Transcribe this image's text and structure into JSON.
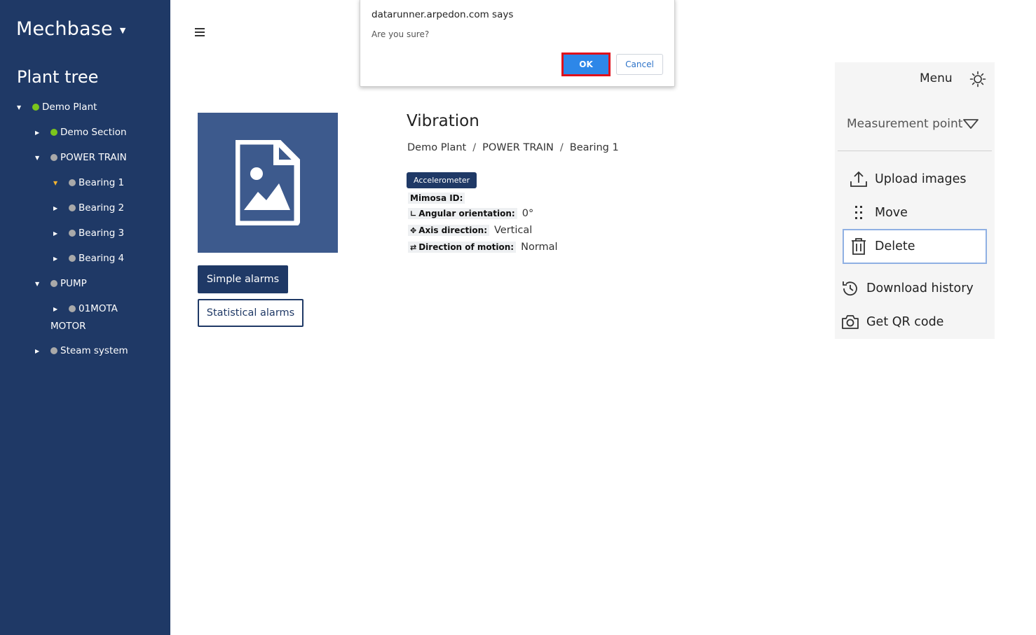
{
  "sidebar": {
    "brand": "Mechbase",
    "tree_title": "Plant tree",
    "nodes": [
      {
        "label": "Demo Plant",
        "status": "green"
      },
      {
        "label": "Demo Section",
        "status": "green"
      },
      {
        "label": "POWER TRAIN",
        "status": "gray"
      },
      {
        "label": "Bearing 1",
        "status": "gray"
      },
      {
        "label": "Bearing 2",
        "status": "gray"
      },
      {
        "label": "Bearing 3",
        "status": "gray"
      },
      {
        "label": "Bearing 4",
        "status": "gray"
      },
      {
        "label": "PUMP",
        "status": "gray"
      },
      {
        "label": "01MOTA",
        "status": "gray"
      },
      {
        "label": "MOTOR",
        "status": "gray"
      },
      {
        "label": "Steam system",
        "status": "gray"
      }
    ]
  },
  "dialog": {
    "title": "datarunner.arpedon.com says",
    "message": "Are you sure?",
    "ok_label": "OK",
    "cancel_label": "Cancel"
  },
  "main": {
    "title": "Vibration",
    "breadcrumb": [
      "Demo Plant",
      "POWER TRAIN",
      "Bearing 1"
    ],
    "breadcrumb_sep": "/",
    "badge": "Accelerometer",
    "props": [
      {
        "key": "Mimosa ID:",
        "value": ""
      },
      {
        "key": "Angular orientation:",
        "value": "0°"
      },
      {
        "key": "Axis direction:",
        "value": "Vertical"
      },
      {
        "key": "Direction of motion:",
        "value": "Normal"
      }
    ],
    "simple_alarms_label": "Simple alarms",
    "statistical_alarms_label": "Statistical alarms"
  },
  "menu": {
    "title": "Menu",
    "selector_label": "Measurement point",
    "items": [
      {
        "label": "Upload images",
        "icon": "upload-icon"
      },
      {
        "label": "Move",
        "icon": "drag-icon"
      },
      {
        "label": "Delete",
        "icon": "trash-icon"
      },
      {
        "label": "Download history",
        "icon": "history-icon"
      },
      {
        "label": "Get QR code",
        "icon": "camera-icon"
      }
    ]
  },
  "colors": {
    "sidebar_bg": "#1f3966",
    "accent_blue": "#2d87e8",
    "status_green": "#7bc51c",
    "status_gray": "#a9a9a9",
    "highlight_red": "#e0101a"
  }
}
